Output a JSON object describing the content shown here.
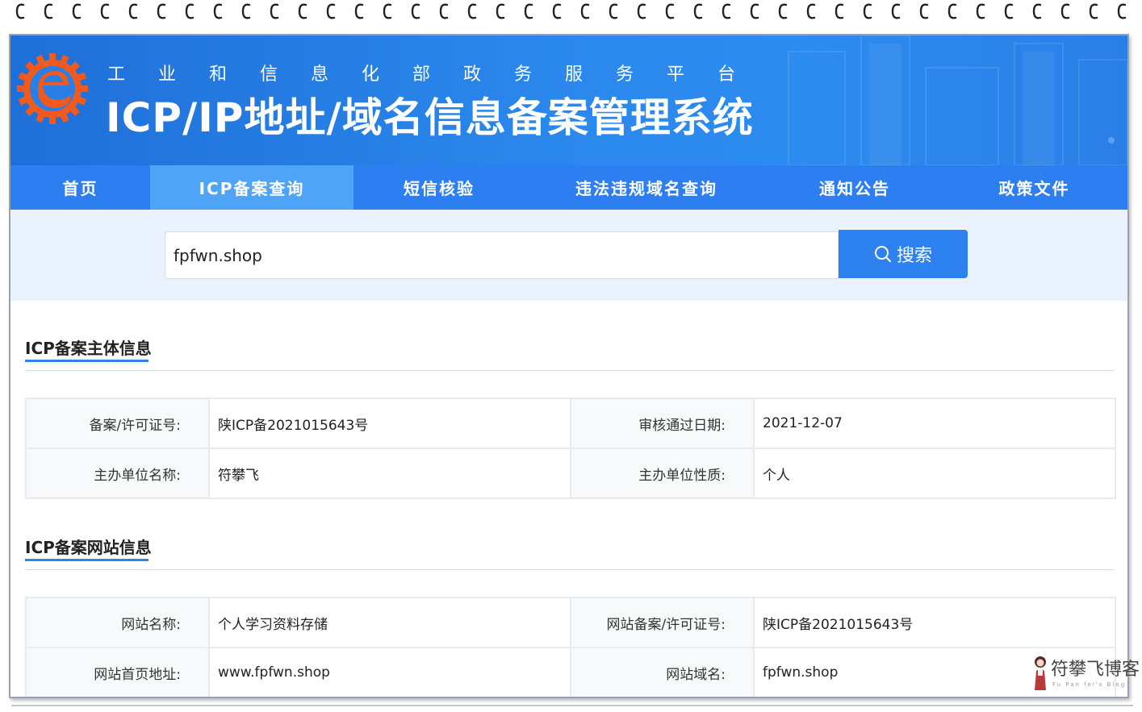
{
  "header": {
    "org_name": "工业和信息化部政务服务平台",
    "system_name": "ICP/IP地址/域名信息备案管理系统"
  },
  "nav": {
    "items": [
      "首页",
      "ICP备案查询",
      "短信核验",
      "违法违规域名查询",
      "通知公告",
      "政策文件"
    ],
    "active": "ICP备案查询"
  },
  "search": {
    "value": "fpfwn.shop",
    "button_label": "搜索",
    "button_icon": "search-icon"
  },
  "subject_section": {
    "title": "ICP备案主体信息",
    "rows": [
      {
        "label1": "备案/许可证号:",
        "value1": "陕ICP备2021015643号",
        "label2": "审核通过日期:",
        "value2": "2021-12-07"
      },
      {
        "label1": "主办单位名称:",
        "value1": "符攀飞",
        "label2": "主办单位性质:",
        "value2": "个人"
      }
    ]
  },
  "site_section": {
    "title": "ICP备案网站信息",
    "rows": [
      {
        "label1": "网站名称:",
        "value1": "个人学习资料存储",
        "label2": "网站备案/许可证号:",
        "value2": "陕ICP备2021015643号"
      },
      {
        "label1": "网站首页地址:",
        "value1": "www.fpfwn.shop",
        "label2": "网站域名:",
        "value2": "fpfwn.shop"
      }
    ]
  },
  "watermark": {
    "text": "符攀飞博客",
    "sub": "Fu Pan fei's Blog"
  },
  "colors": {
    "banner": "#2a86ea",
    "nav": "#2d7ef0",
    "nav_active": "#4fa4f8",
    "search_strip": "#eaf3fd",
    "accent": "#2e82f0",
    "logo_orange": "#f05a1e"
  }
}
